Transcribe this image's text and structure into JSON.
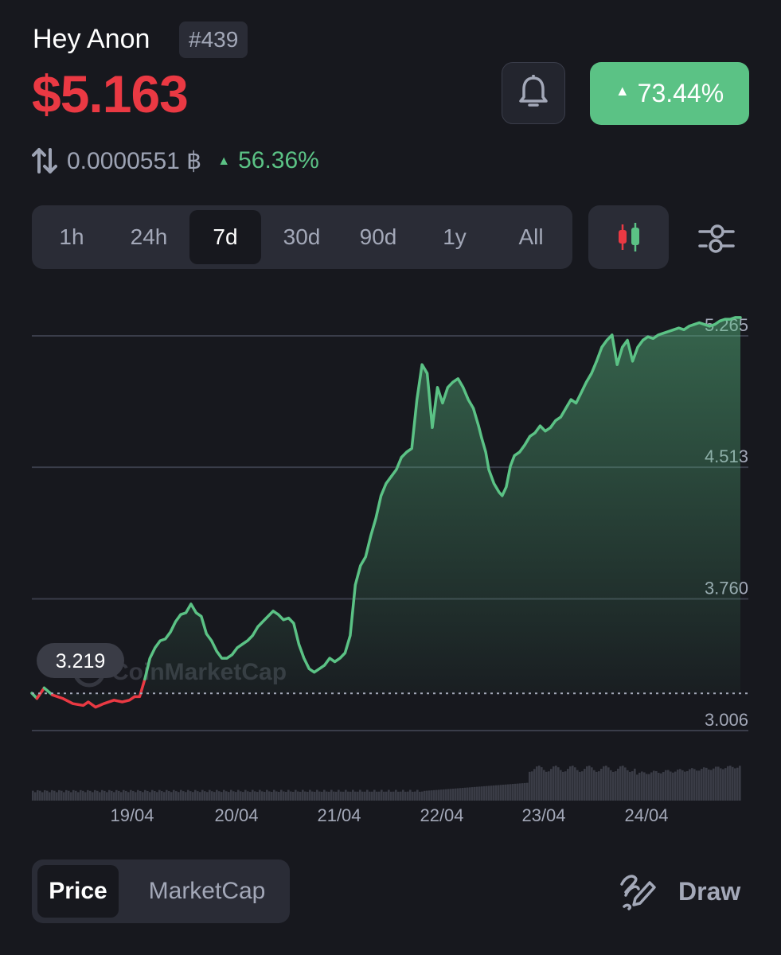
{
  "header": {
    "name": "Hey Anon",
    "rank": "#439",
    "price": "$5.163",
    "change_7d": "73.44%",
    "btc_price": "0.0000551 ฿",
    "btc_change": "56.36%"
  },
  "icons": {
    "bell": "bell-icon",
    "swap": "swap-arrows-icon",
    "candles": "candlestick-icon",
    "filter": "sliders-icon",
    "draw": "draw-pen-icon"
  },
  "range_tabs": [
    {
      "label": "1h",
      "active": false
    },
    {
      "label": "24h",
      "active": false
    },
    {
      "label": "7d",
      "active": true
    },
    {
      "label": "30d",
      "active": false
    },
    {
      "label": "90d",
      "active": false
    },
    {
      "label": "1y",
      "active": false
    },
    {
      "label": "All",
      "active": false
    }
  ],
  "bottom": {
    "toggle": [
      {
        "label": "Price",
        "active": true
      },
      {
        "label": "MarketCap",
        "active": false
      }
    ],
    "draw_label": "Draw"
  },
  "colors": {
    "up": "#5bc285",
    "down": "#ea3943",
    "background": "#17181e",
    "panel": "#2a2c36",
    "muted": "#a3a8b8"
  },
  "chart_data": {
    "type": "line",
    "y_ticks": [
      "5.265",
      "4.513",
      "3.760",
      "3.006"
    ],
    "ylim": [
      3.006,
      5.265
    ],
    "x_ticks": [
      "19/04",
      "20/04",
      "21/04",
      "22/04",
      "23/04",
      "24/04"
    ],
    "baseline_label": "3.219",
    "baseline": 3.219,
    "watermark": "CoinMarketCap",
    "series": [
      {
        "x": [
          0.0,
          0.05,
          0.12,
          0.2,
          0.3,
          0.4,
          0.5,
          0.55,
          0.62,
          0.7,
          0.8,
          0.88,
          0.95,
          1.0,
          1.05,
          1.1,
          1.15,
          1.2,
          1.25,
          1.3,
          1.35,
          1.4,
          1.45,
          1.5,
          1.55,
          1.6,
          1.65,
          1.7,
          1.75,
          1.8,
          1.85,
          1.9,
          1.95,
          2.0,
          2.05,
          2.1,
          2.15,
          2.2,
          2.25,
          2.3,
          2.35,
          2.4,
          2.45,
          2.5,
          2.55,
          2.6,
          2.65,
          2.7,
          2.75,
          2.8,
          2.85,
          2.9,
          2.95,
          3.0,
          3.05,
          3.1,
          3.15,
          3.2,
          3.25,
          3.3,
          3.35,
          3.4,
          3.45,
          3.5,
          3.55,
          3.6,
          3.65,
          3.7,
          3.75,
          3.8,
          3.85,
          3.9,
          3.95,
          4.0,
          4.05,
          4.1,
          4.15,
          4.2,
          4.25,
          4.3,
          4.35,
          4.38,
          4.42,
          4.45,
          4.5,
          4.55,
          4.58,
          4.62,
          4.66,
          4.7,
          4.75,
          4.8,
          4.85,
          4.9,
          4.95,
          5.0,
          5.05,
          5.1,
          5.15,
          5.2,
          5.25,
          5.3,
          5.35,
          5.4,
          5.45,
          5.5,
          5.55,
          5.6,
          5.65,
          5.7,
          5.75,
          5.8,
          5.85,
          5.9,
          5.95,
          6.0,
          6.05,
          6.1,
          6.15,
          6.2,
          6.25,
          6.3,
          6.35,
          6.4,
          6.45,
          6.5,
          6.55,
          6.6,
          6.65,
          6.7,
          6.75,
          6.8,
          6.85,
          6.9
        ],
        "y": [
          3.22,
          3.19,
          3.25,
          3.21,
          3.19,
          3.16,
          3.15,
          3.17,
          3.14,
          3.16,
          3.18,
          3.17,
          3.18,
          3.2,
          3.2,
          3.3,
          3.42,
          3.48,
          3.52,
          3.53,
          3.57,
          3.63,
          3.67,
          3.68,
          3.73,
          3.68,
          3.66,
          3.56,
          3.52,
          3.46,
          3.42,
          3.42,
          3.44,
          3.48,
          3.5,
          3.52,
          3.55,
          3.6,
          3.63,
          3.66,
          3.69,
          3.67,
          3.64,
          3.65,
          3.62,
          3.5,
          3.42,
          3.36,
          3.34,
          3.36,
          3.38,
          3.42,
          3.4,
          3.42,
          3.45,
          3.55,
          3.84,
          3.95,
          4.0,
          4.12,
          4.22,
          4.35,
          4.42,
          4.46,
          4.5,
          4.57,
          4.6,
          4.62,
          4.9,
          5.1,
          5.05,
          4.74,
          4.97,
          4.88,
          4.97,
          5.0,
          5.02,
          4.97,
          4.9,
          4.85,
          4.75,
          4.68,
          4.6,
          4.5,
          4.42,
          4.37,
          4.35,
          4.4,
          4.52,
          4.58,
          4.6,
          4.64,
          4.69,
          4.71,
          4.75,
          4.72,
          4.74,
          4.78,
          4.8,
          4.85,
          4.9,
          4.88,
          4.94,
          5.0,
          5.05,
          5.12,
          5.2,
          5.24,
          5.27,
          5.1,
          5.2,
          5.24,
          5.12,
          5.2,
          5.24,
          5.26,
          5.25,
          5.27,
          5.28,
          5.29,
          5.3,
          5.31,
          5.3,
          5.32,
          5.33,
          5.34,
          5.33,
          5.32,
          5.33,
          5.35,
          5.36,
          5.36,
          5.37,
          5.37
        ]
      }
    ],
    "volume_shape": "low and flat through 22/04, rising around 23/04 and staying elevated"
  }
}
